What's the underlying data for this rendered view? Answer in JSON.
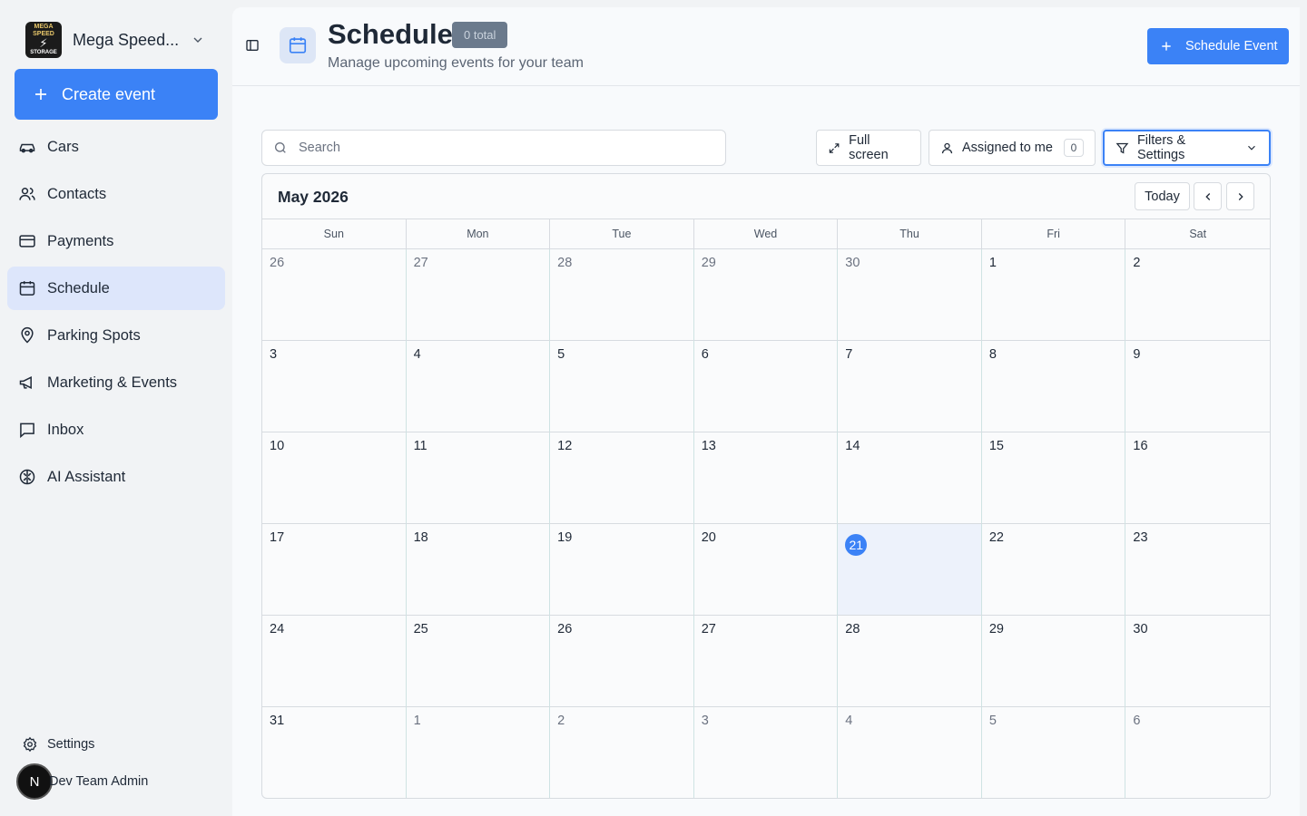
{
  "sidebar": {
    "brand": {
      "name": "Mega Speed...",
      "logo_top": "MEGA SPEED",
      "logo_bottom": "STORAGE"
    },
    "create_label": "Create event",
    "items": [
      {
        "label": "Cars",
        "icon": "car-icon"
      },
      {
        "label": "Contacts",
        "icon": "users-icon"
      },
      {
        "label": "Payments",
        "icon": "credit-card-icon"
      },
      {
        "label": "Schedule",
        "icon": "calendar-icon",
        "active": true
      },
      {
        "label": "Parking Spots",
        "icon": "map-pin-icon"
      },
      {
        "label": "Marketing & Events",
        "icon": "megaphone-icon"
      },
      {
        "label": "Inbox",
        "icon": "message-square-icon"
      },
      {
        "label": "AI Assistant",
        "icon": "brain-icon"
      }
    ],
    "settings_label": "Settings",
    "user": {
      "initial": "N",
      "name": "Dev Team Admin"
    }
  },
  "header": {
    "title": "Schedule",
    "badge": "0 total",
    "subtitle": "Manage upcoming events for your team",
    "schedule_button": "Schedule Event"
  },
  "toolbar": {
    "search_placeholder": "Search",
    "fullscreen_label": "Full screen",
    "assigned_label": "Assigned to me",
    "assigned_count": "0",
    "filters_label": "Filters & Settings"
  },
  "calendar": {
    "month_label": "May 2026",
    "today_label": "Today",
    "weekdays": [
      "Sun",
      "Mon",
      "Tue",
      "Wed",
      "Thu",
      "Fri",
      "Sat"
    ],
    "days": [
      {
        "n": "26",
        "out": true
      },
      {
        "n": "27",
        "out": true
      },
      {
        "n": "28",
        "out": true
      },
      {
        "n": "29",
        "out": true
      },
      {
        "n": "30",
        "out": true
      },
      {
        "n": "1"
      },
      {
        "n": "2"
      },
      {
        "n": "3"
      },
      {
        "n": "4"
      },
      {
        "n": "5"
      },
      {
        "n": "6"
      },
      {
        "n": "7"
      },
      {
        "n": "8"
      },
      {
        "n": "9"
      },
      {
        "n": "10"
      },
      {
        "n": "11"
      },
      {
        "n": "12"
      },
      {
        "n": "13"
      },
      {
        "n": "14"
      },
      {
        "n": "15"
      },
      {
        "n": "16"
      },
      {
        "n": "17"
      },
      {
        "n": "18"
      },
      {
        "n": "19"
      },
      {
        "n": "20"
      },
      {
        "n": "21",
        "today": true
      },
      {
        "n": "22"
      },
      {
        "n": "23"
      },
      {
        "n": "24"
      },
      {
        "n": "25"
      },
      {
        "n": "26"
      },
      {
        "n": "27"
      },
      {
        "n": "28"
      },
      {
        "n": "29"
      },
      {
        "n": "30"
      },
      {
        "n": "31"
      },
      {
        "n": "1",
        "out": true
      },
      {
        "n": "2",
        "out": true
      },
      {
        "n": "3",
        "out": true
      },
      {
        "n": "4",
        "out": true
      },
      {
        "n": "5",
        "out": true
      },
      {
        "n": "6",
        "out": true
      }
    ]
  },
  "colors": {
    "accent": "#3b82f6",
    "active_nav": "#dde6fb",
    "today_cell": "#edf2fb"
  }
}
